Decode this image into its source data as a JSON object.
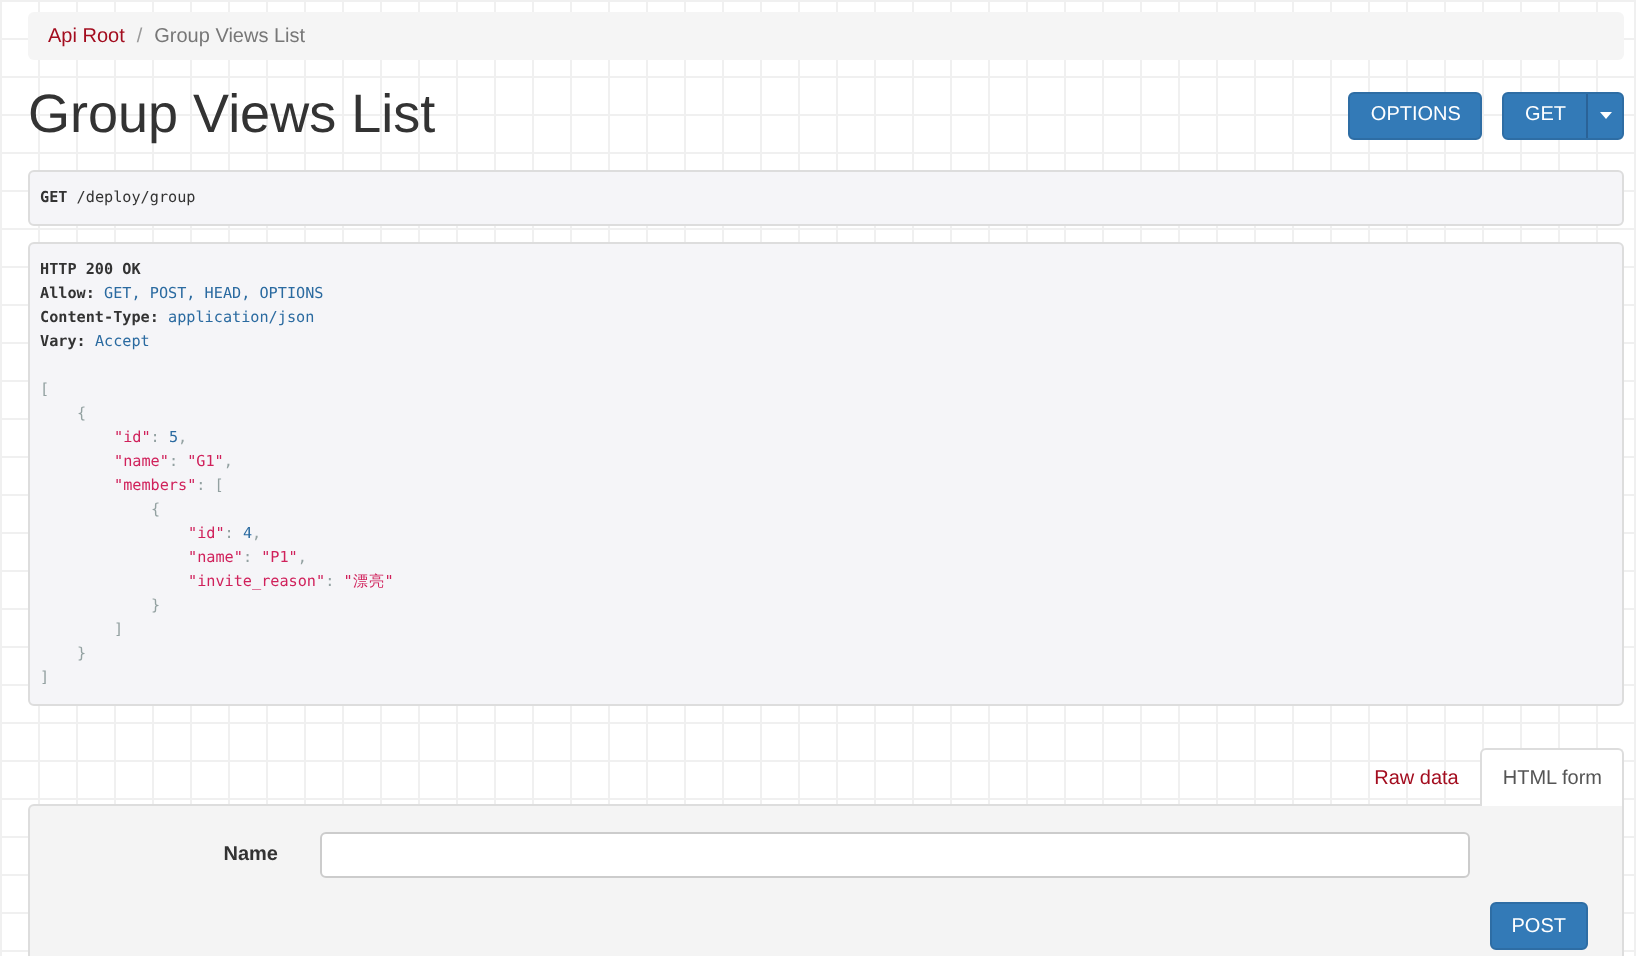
{
  "breadcrumb": [
    {
      "label": "Api Root",
      "selected": false
    },
    {
      "label": "Group Views List",
      "selected": true
    }
  ],
  "breadcrumb_separator": "/",
  "title": "Group Views List",
  "actions": [
    {
      "label": "OPTIONS",
      "kind": "button"
    },
    {
      "label": "GET",
      "kind": "split"
    }
  ],
  "request": {
    "method": "GET",
    "path": "/deploy/group"
  },
  "response": {
    "status": "HTTP 200 OK",
    "headers": [
      {
        "name": "Allow:",
        "value": "GET, POST, HEAD, OPTIONS"
      },
      {
        "name": "Content-Type:",
        "value": "application/json"
      },
      {
        "name": "Vary:",
        "value": "Accept"
      }
    ],
    "body": [
      {
        "tokens": [
          {
            "kind": "punct",
            "text": "["
          }
        ],
        "children": [
          {
            "tokens": [
              {
                "kind": "punct",
                "text": "{"
              }
            ],
            "children": [
              {
                "tokens": [
                  {
                    "kind": "key",
                    "text": "\"id\""
                  },
                  {
                    "kind": "punct",
                    "text": ": "
                  },
                  {
                    "kind": "number",
                    "text": "5"
                  },
                  {
                    "kind": "punct",
                    "text": ","
                  }
                ]
              },
              {
                "tokens": [
                  {
                    "kind": "key",
                    "text": "\"name\""
                  },
                  {
                    "kind": "punct",
                    "text": ": "
                  },
                  {
                    "kind": "string",
                    "text": "\"G1\""
                  },
                  {
                    "kind": "punct",
                    "text": ","
                  }
                ]
              },
              {
                "tokens": [
                  {
                    "kind": "key",
                    "text": "\"members\""
                  },
                  {
                    "kind": "punct",
                    "text": ": ["
                  }
                ],
                "children": [
                  {
                    "tokens": [
                      {
                        "kind": "punct",
                        "text": "{"
                      }
                    ],
                    "children": [
                      {
                        "tokens": [
                          {
                            "kind": "key",
                            "text": "\"id\""
                          },
                          {
                            "kind": "punct",
                            "text": ": "
                          },
                          {
                            "kind": "number",
                            "text": "4"
                          },
                          {
                            "kind": "punct",
                            "text": ","
                          }
                        ]
                      },
                      {
                        "tokens": [
                          {
                            "kind": "key",
                            "text": "\"name\""
                          },
                          {
                            "kind": "punct",
                            "text": ": "
                          },
                          {
                            "kind": "string",
                            "text": "\"P1\""
                          },
                          {
                            "kind": "punct",
                            "text": ","
                          }
                        ]
                      },
                      {
                        "tokens": [
                          {
                            "kind": "key",
                            "text": "\"invite_reason\""
                          },
                          {
                            "kind": "punct",
                            "text": ": "
                          },
                          {
                            "kind": "string",
                            "text": "\"漂亮\""
                          }
                        ]
                      }
                    ]
                  },
                  {
                    "tokens": [
                      {
                        "kind": "punct",
                        "text": "}"
                      }
                    ]
                  }
                ]
              },
              {
                "tokens": [
                  {
                    "kind": "punct",
                    "text": "]"
                  }
                ]
              }
            ]
          },
          {
            "tokens": [
              {
                "kind": "punct",
                "text": "}"
              }
            ]
          }
        ]
      },
      {
        "tokens": [
          {
            "kind": "punct",
            "text": "]"
          }
        ]
      }
    ]
  },
  "form_tabs": [
    {
      "label": "Raw data",
      "selected": false
    },
    {
      "label": "HTML form",
      "selected": true
    }
  ],
  "form": {
    "fields": [
      {
        "label": "Name"
      }
    ],
    "submit": "POST"
  }
}
